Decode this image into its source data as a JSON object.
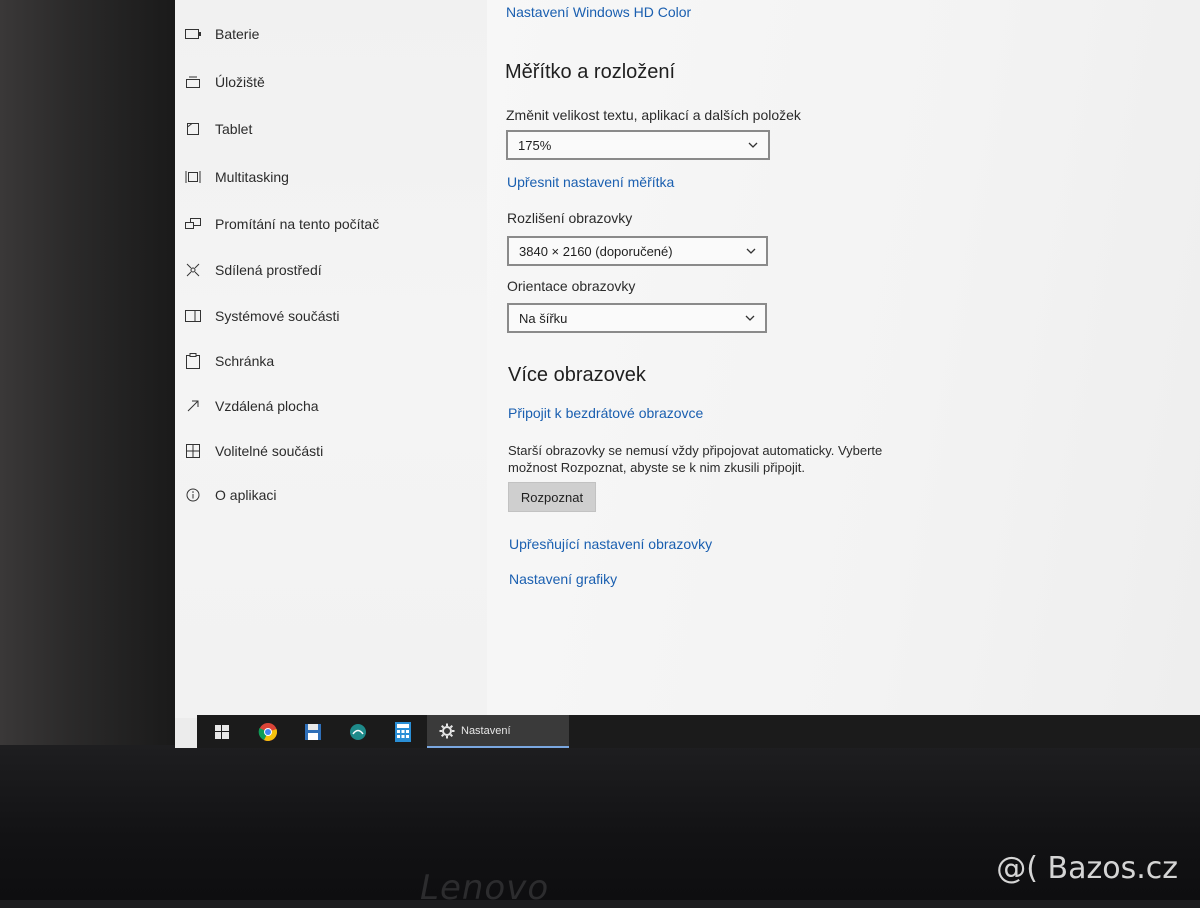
{
  "sidebar": {
    "items": [
      {
        "label": "Baterie",
        "icon": "battery-icon"
      },
      {
        "label": "Úložiště",
        "icon": "storage-icon"
      },
      {
        "label": "Tablet",
        "icon": "tablet-icon"
      },
      {
        "label": "Multitasking",
        "icon": "multitasking-icon"
      },
      {
        "label": "Promítání na tento počítač",
        "icon": "projecting-icon"
      },
      {
        "label": "Sdílená prostředí",
        "icon": "shared-experiences-icon"
      },
      {
        "label": "Systémové součásti",
        "icon": "system-components-icon"
      },
      {
        "label": "Schránka",
        "icon": "clipboard-icon"
      },
      {
        "label": "Vzdálená plocha",
        "icon": "remote-desktop-icon"
      },
      {
        "label": "Volitelné součásti",
        "icon": "optional-features-icon"
      },
      {
        "label": "O aplikaci",
        "icon": "info-icon"
      }
    ]
  },
  "content": {
    "hd_color_link": "Nastavení Windows HD Color",
    "scale_heading": "Měřítko a rozložení",
    "scale_label": "Změnit velikost textu, aplikací a dalších položek",
    "scale_value": "175%",
    "advanced_scaling_link": "Upřesnit nastavení měřítka",
    "resolution_label": "Rozlišení obrazovky",
    "resolution_value": "3840 × 2160 (doporučené)",
    "orientation_label": "Orientace obrazovky",
    "orientation_value": "Na šířku",
    "multi_heading": "Více obrazovek",
    "wireless_link": "Připojit k bezdrátové obrazovce",
    "detect_desc": "Starší obrazovky se nemusí vždy připojovat automaticky. Vyberte možnost Rozpoznat, abyste se k nim zkusili připojit.",
    "detect_button": "Rozpoznat",
    "advanced_display_link": "Upřesňující nastavení obrazovky",
    "graphics_link": "Nastavení grafiky"
  },
  "taskbar": {
    "icons": [
      "windows-start-icon",
      "chrome-icon",
      "floppy-save-icon",
      "app-icon",
      "calculator-icon"
    ],
    "active_window_label": "Nastavení"
  },
  "bezel": {
    "brand": "Lenovo",
    "watermark": "@( Bazos.cz"
  },
  "colors": {
    "link": "#1a5fb0",
    "taskbar": "#1b1b1b"
  }
}
